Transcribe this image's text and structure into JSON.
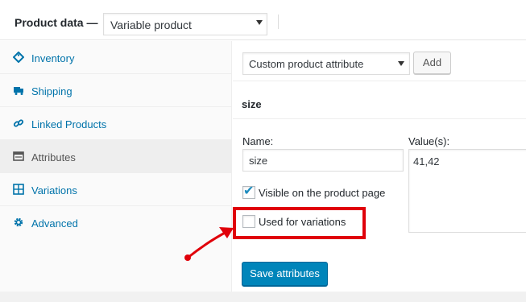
{
  "header": {
    "title": "Product data —",
    "product_type": "Variable product"
  },
  "tabs": [
    {
      "label": "Inventory",
      "icon": "tag-icon",
      "active": false
    },
    {
      "label": "Shipping",
      "icon": "truck-icon",
      "active": false
    },
    {
      "label": "Linked Products",
      "icon": "link-icon",
      "active": false
    },
    {
      "label": "Attributes",
      "icon": "list-icon",
      "active": true
    },
    {
      "label": "Variations",
      "icon": "grid-icon",
      "active": false
    },
    {
      "label": "Advanced",
      "icon": "gear-icon",
      "active": false
    }
  ],
  "attributes": {
    "select_value": "Custom product attribute",
    "add_label": "Add",
    "attr_name_heading": "size",
    "name_label": "Name:",
    "name_value": "size",
    "values_label": "Value(s):",
    "values_value": "41,42",
    "visible_label": "Visible on the product page",
    "visible_checked": true,
    "variations_label": "Used for variations",
    "variations_checked": false,
    "save_label": "Save attributes"
  },
  "colors": {
    "link": "#0073aa",
    "primary_button": "#0085ba",
    "highlight": "#e0000a"
  }
}
